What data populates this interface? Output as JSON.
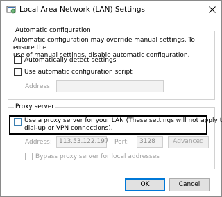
{
  "window": {
    "title": "Local Area Network (LAN) Settings"
  },
  "automatic": {
    "legend": "Automatic configuration",
    "description_line1": "Automatic configuration may override manual settings.  To ensure the",
    "description_line2": "use of manual settings, disable automatic configuration.",
    "auto_detect_label": "Automatically detect settings",
    "auto_detect_checked": false,
    "use_script_label": "Use automatic configuration script",
    "use_script_checked": false,
    "address_label": "Address",
    "address_value": ""
  },
  "proxy": {
    "legend": "Proxy server",
    "use_proxy_line1": "Use a proxy server for your LAN (These settings will not apply to",
    "use_proxy_line2": "dial-up or VPN connections).",
    "use_proxy_checked": false,
    "address_label": "Address:",
    "address_value": "113.53.122.197",
    "port_label": "Port:",
    "port_value": "3128",
    "advanced_label": "Advanced",
    "bypass_label": "Bypass proxy server for local addresses",
    "bypass_checked": false
  },
  "buttons": {
    "ok": "OK",
    "cancel": "Cancel"
  },
  "icons": {
    "app": "network-settings-icon",
    "close": "close-icon"
  },
  "colors": {
    "highlight_border": "#000000",
    "primary_button_border": "#0078d7",
    "checkbox_focus_border": "#3c7fb1"
  }
}
